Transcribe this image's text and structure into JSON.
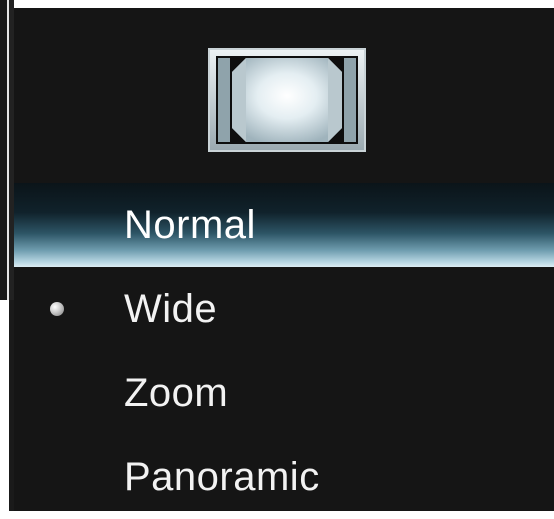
{
  "menu": {
    "icon": "aspect-ratio-screen-icon",
    "items": [
      {
        "label": "Normal",
        "highlighted": true,
        "active": false
      },
      {
        "label": "Wide",
        "highlighted": false,
        "active": true
      },
      {
        "label": "Zoom",
        "highlighted": false,
        "active": false
      },
      {
        "label": "Panoramic",
        "highlighted": false,
        "active": false
      }
    ]
  },
  "colors": {
    "panel_background": "#151515",
    "text": "#f2f2f2",
    "highlight_light": "#dcecf3",
    "highlight_dark": "#0b1419"
  }
}
